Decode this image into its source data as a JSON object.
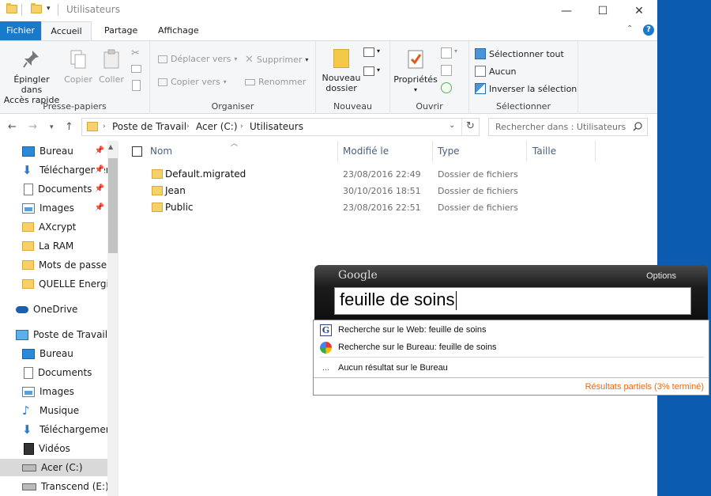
{
  "window": {
    "title": "Utilisateurs",
    "controls": {
      "minimize": "—",
      "maximize": "☐",
      "close": "✕"
    }
  },
  "ribbon_tabs": [
    {
      "label": "Fichier"
    },
    {
      "label": "Accueil"
    },
    {
      "label": "Partage"
    },
    {
      "label": "Affichage"
    }
  ],
  "ribbon": {
    "presse_papiers": {
      "label": "Presse-papiers",
      "pin": "Épingler dans Accès rapide",
      "pin_l1": "Épingler dans",
      "pin_l2": "Accès rapide",
      "copy": "Copier",
      "paste": "Coller"
    },
    "organiser": {
      "label": "Organiser",
      "move": "Déplacer vers",
      "copy_to": "Copier vers",
      "delete": "Supprimer",
      "rename": "Renommer"
    },
    "nouveau": {
      "label": "Nouveau",
      "new_folder_l1": "Nouveau",
      "new_folder_l2": "dossier"
    },
    "ouvrir": {
      "label": "Ouvrir",
      "properties": "Propriétés"
    },
    "selectionner": {
      "label": "Sélectionner",
      "all": "Sélectionner tout",
      "none": "Aucun",
      "invert": "Inverser la sélection"
    }
  },
  "address": {
    "segments": [
      "Poste de Travail",
      "Acer (C:)",
      "Utilisateurs"
    ],
    "search_placeholder": "Rechercher dans : Utilisateurs"
  },
  "sidebar": {
    "quick": [
      {
        "label": "Bureau",
        "icon": "blue",
        "pinned": true
      },
      {
        "label": "Téléchargements",
        "icon": "download",
        "pinned": true
      },
      {
        "label": "Documents",
        "icon": "doc",
        "pinned": true
      },
      {
        "label": "Images",
        "icon": "img",
        "pinned": true
      },
      {
        "label": "AXcrypt",
        "icon": "folder"
      },
      {
        "label": "La RAM",
        "icon": "folder"
      },
      {
        "label": "Mots de passe",
        "icon": "folder"
      },
      {
        "label": "QUELLE Energie",
        "icon": "folder"
      }
    ],
    "onedrive": "OneDrive",
    "pc": "Poste de Travail",
    "pc_items": [
      {
        "label": "Bureau",
        "icon": "blue"
      },
      {
        "label": "Documents",
        "icon": "doc"
      },
      {
        "label": "Images",
        "icon": "img"
      },
      {
        "label": "Musique",
        "icon": "music"
      },
      {
        "label": "Téléchargements",
        "icon": "download"
      },
      {
        "label": "Vidéos",
        "icon": "video"
      },
      {
        "label": "Acer (C:)",
        "icon": "drive",
        "selected": true
      },
      {
        "label": "Transcend (E:)",
        "icon": "drive"
      }
    ]
  },
  "columns": {
    "name": "Nom",
    "modified": "Modifié le",
    "type": "Type",
    "size": "Taille"
  },
  "files": [
    {
      "name": "Default.migrated",
      "modified": "23/08/2016 22:49",
      "type": "Dossier de fichiers"
    },
    {
      "name": "Jean",
      "modified": "30/10/2016 18:51",
      "type": "Dossier de fichiers"
    },
    {
      "name": "Public",
      "modified": "23/08/2016 22:51",
      "type": "Dossier de fichiers"
    }
  ],
  "google_desktop": {
    "logo": "Google",
    "options": "Options",
    "query": "feuille de soins",
    "web_search": "Recherche sur le Web: feuille de soins",
    "desktop_search": "Recherche sur le Bureau: feuille de soins",
    "no_result": "Aucun résultat sur le Bureau",
    "no_result_prefix": "...",
    "status": "Résultats partiels (3% terminé)"
  }
}
